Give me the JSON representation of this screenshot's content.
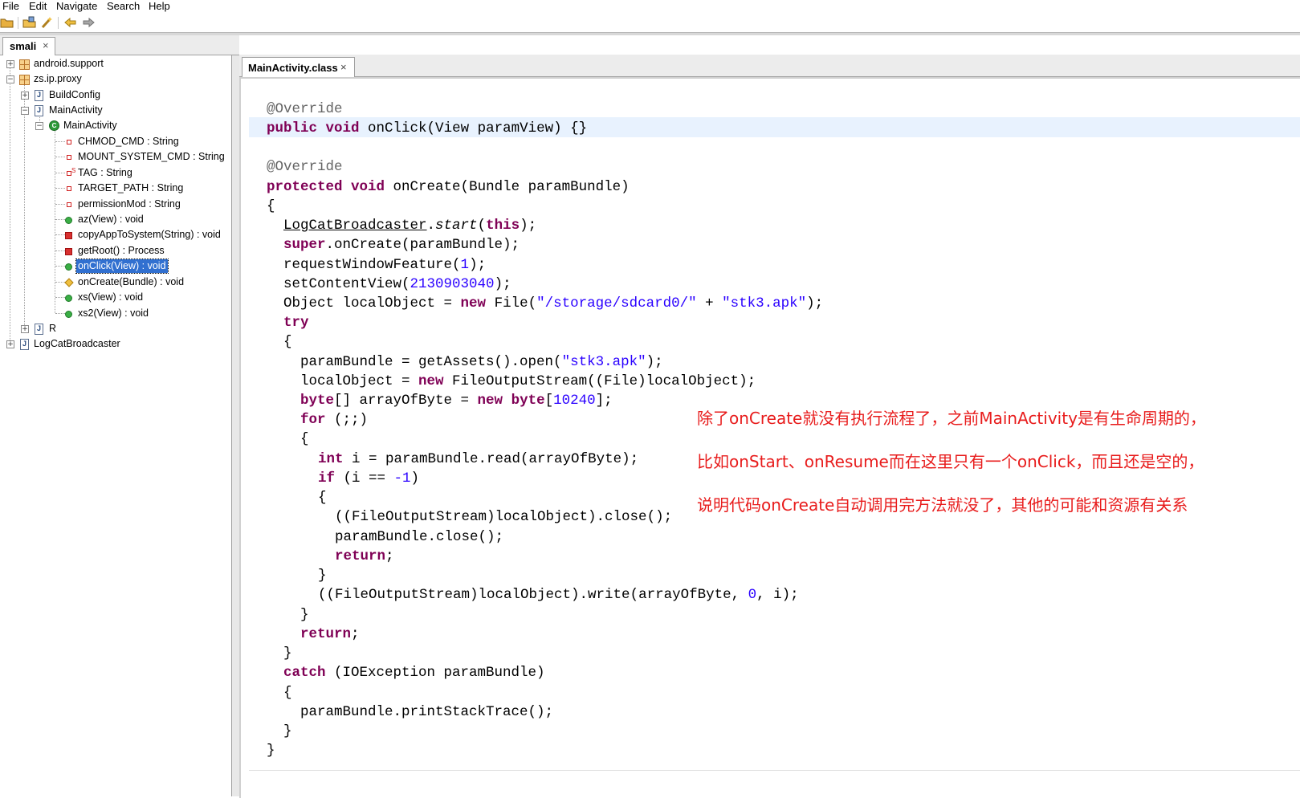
{
  "menu": [
    "File",
    "Edit",
    "Navigate",
    "Search",
    "Help"
  ],
  "toolbar": {
    "icons": [
      "open-folder-icon",
      "open-file-icon",
      "wand-icon",
      "back-arrow-icon",
      "forward-arrow-icon"
    ]
  },
  "left_tab": {
    "label": "smali",
    "close": "×"
  },
  "editor_tab": {
    "label": "MainActivity.class",
    "close": "×"
  },
  "tree": {
    "items": [
      {
        "label": "android.support"
      },
      {
        "label": "zs.ip.proxy"
      },
      {
        "label": "BuildConfig"
      },
      {
        "label": "MainActivity"
      },
      {
        "label": "MainActivity"
      },
      {
        "label": "CHMOD_CMD : String"
      },
      {
        "label": "MOUNT_SYSTEM_CMD : String"
      },
      {
        "label": "TAG : String"
      },
      {
        "label": "TARGET_PATH : String"
      },
      {
        "label": "permissionMod : String"
      },
      {
        "label": "az(View) : void"
      },
      {
        "label": "copyAppToSystem(String) : void"
      },
      {
        "label": "getRoot() : Process"
      },
      {
        "label": "onClick(View) : void"
      },
      {
        "label": "onCreate(Bundle) : void"
      },
      {
        "label": "xs(View) : void"
      },
      {
        "label": "xs2(View) : void"
      },
      {
        "label": "R"
      },
      {
        "label": "LogCatBroadcaster"
      }
    ]
  },
  "code": {
    "l0": "@Override",
    "l1_kw1": "public",
    "l1_kw2": "void",
    "l1_rest": " onClick(View paramView) {}",
    "l2": "@Override",
    "l3_kw1": "protected",
    "l3_kw2": "void",
    "l3_rest": " onCreate(Bundle paramBundle)",
    "l4": "{",
    "l5_cls": "LogCatBroadcaster",
    "l5_dot": ".",
    "l5_m": "start",
    "l5_open": "(",
    "l5_kw": "this",
    "l5_end": ");",
    "l6_kw": "super",
    "l6_rest": ".onCreate(paramBundle);",
    "l7_a": "requestWindowFeature(",
    "l7_n": "1",
    "l7_b": ");",
    "l8_a": "setContentView(",
    "l8_n": "2130903040",
    "l8_b": ");",
    "l9_a": "Object localObject = ",
    "l9_kw": "new",
    "l9_b": " File(",
    "l9_s1": "\"/storage/sdcard0/\"",
    "l9_c": " + ",
    "l9_s2": "\"stk3.apk\"",
    "l9_d": ");",
    "l10_kw": "try",
    "l11": "{",
    "l12_a": "paramBundle = getAssets().open(",
    "l12_s": "\"stk3.apk\"",
    "l12_b": ");",
    "l13_a": "localObject = ",
    "l13_kw": "new",
    "l13_b": " FileOutputStream((File)localObject);",
    "l14_kw1": "byte",
    "l14_a": "[] arrayOfByte = ",
    "l14_kw2": "new",
    "l14_sp": " ",
    "l14_kw3": "byte",
    "l14_b": "[",
    "l14_n": "10240",
    "l14_c": "];",
    "l15_kw": "for",
    "l15_rest": " (;;)",
    "l16": "{",
    "l17_kw": "int",
    "l17_rest": " i = paramBundle.read(arrayOfByte);",
    "l18_kw": "if",
    "l18_a": " (i == ",
    "l18_n": "-1",
    "l18_b": ")",
    "l19": "{",
    "l20": "((FileOutputStream)localObject).close();",
    "l21": "paramBundle.close();",
    "l22_kw": "return",
    "l22_rest": ";",
    "l23": "}",
    "l24_a": "((FileOutputStream)localObject).write(arrayOfByte, ",
    "l24_n": "0",
    "l24_b": ", i);",
    "l25": "}",
    "l26_kw": "return",
    "l26_rest": ";",
    "l27": "}",
    "l28_kw": "catch",
    "l28_rest": " (IOException paramBundle)",
    "l29": "{",
    "l30": "paramBundle.printStackTrace();",
    "l31": "}",
    "l32": "}"
  },
  "annotation": {
    "line1": "除了onCreate就没有执行流程了，之前MainActivity是有生命周期的，",
    "line2": "比如onStart、onResume而在这里只有一个onClick，而且还是空的，",
    "line3": "说明代码onCreate自动调用完方法就没了，其他的可能和资源有关系"
  },
  "colors": {
    "keyword": "#7f0055",
    "string": "#2a00ff",
    "annotation": "#646464",
    "note": "#e81c1c",
    "selection": "#3170d0"
  }
}
